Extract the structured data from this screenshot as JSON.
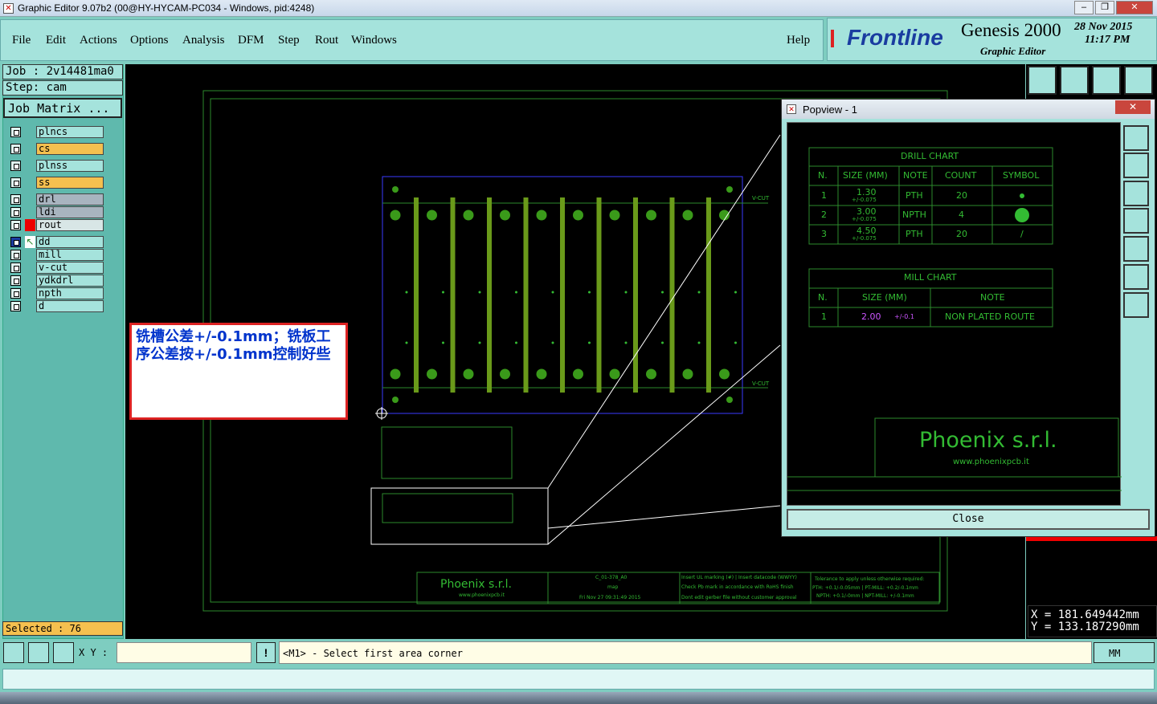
{
  "window": {
    "title": "Graphic Editor 9.07b2 (00@HY-HYCAM-PC034 - Windows, pid:4248)",
    "minimize": "–",
    "restore": "❐",
    "close": "✕"
  },
  "menu": [
    "File",
    "Edit",
    "Actions",
    "Options",
    "Analysis",
    "DFM",
    "Step",
    "Rout",
    "Windows"
  ],
  "help": "Help",
  "brand": {
    "logo": "Frontline",
    "product": "Genesis 2000",
    "subtitle": "Graphic Editor",
    "date": "28 Nov 2015",
    "time": "11:17 PM"
  },
  "job": {
    "job": "Job : 2v14481ma0",
    "step": "Step: cam",
    "matrix_button": "Job Matrix ..."
  },
  "layers": [
    {
      "name": "plncs",
      "color": "#a5e3dc"
    },
    {
      "name": "cs",
      "color": "#f5c04f"
    },
    {
      "name": "plnss",
      "color": "#a5e3dc"
    },
    {
      "name": "ss",
      "color": "#f5c04f"
    },
    {
      "name": "drl",
      "color": "#a8b4bf"
    },
    {
      "name": "ldi",
      "color": "#a8b4bf"
    },
    {
      "name": "rout",
      "color": "#a5e3dc"
    },
    {
      "name": "dd",
      "color": "#a5e3dc"
    },
    {
      "name": "mill",
      "color": "#a5e3dc"
    },
    {
      "name": "v-cut",
      "color": "#a5e3dc"
    },
    {
      "name": "ydkdrl",
      "color": "#a5e3dc"
    },
    {
      "name": "npth",
      "color": "#a5e3dc"
    },
    {
      "name": "d",
      "color": "#a5e3dc"
    }
  ],
  "selected": "Selected : 76",
  "annotation": {
    "line1": "铣槽公差+/-0.1mm；铣板工",
    "line2": "序公差按+/-0.1mm控制好些"
  },
  "popview": {
    "title": "Popview - 1",
    "close_label": "Close",
    "drill_chart": {
      "title": "DRILL CHART",
      "headers": [
        "N.",
        "SIZE (MM)",
        "NOTE",
        "COUNT",
        "SYMBOL"
      ],
      "rows": [
        {
          "n": "1",
          "size": "1.30",
          "tol": "+/-0.075",
          "note": "PTH",
          "count": "20"
        },
        {
          "n": "2",
          "size": "3.00",
          "tol": "+/-0.075",
          "note": "NPTH",
          "count": "4"
        },
        {
          "n": "3",
          "size": "4.50",
          "tol": "+/-0.075",
          "note": "PTH",
          "count": "20",
          "symbol": "/"
        }
      ]
    },
    "mill_chart": {
      "title": "MILL CHART",
      "headers": [
        "N.",
        "SIZE (MM)",
        "NOTE"
      ],
      "rows": [
        {
          "n": "1",
          "size": "2.00",
          "tol": "+/-0.1",
          "note": "NON PLATED ROUTE"
        }
      ]
    },
    "company": "Phoenix s.r.l.",
    "website": "www.phoenixpcb.it"
  },
  "board": {
    "vcut_label": "V-CUT",
    "title_block": {
      "company": "Phoenix s.r.l.",
      "website": "www.phoenixpcb.it",
      "part": "C_01-378_A0",
      "step": "map",
      "date": "Fri Nov 27 09:31:49 2015",
      "note1": "Insert UL marking (#) | Insert datacode (WWYY)",
      "note2": "Check Pb mark in accordance with RoHS finish",
      "note3": "Dont edit gerber file without customer approval",
      "tol_title": "Tolerance to apply unless otherwise required:",
      "tol1": "PTH: +0.1/-0.05mm | PT-MILL: +0.2/-0.1mm",
      "tol2": "NPTH: +0.1/-0mm | NPT-MILL: +/-0.1mm"
    }
  },
  "coords": {
    "x": "X = 181.649442mm",
    "y": "Y = 133.187290mm"
  },
  "status": {
    "xy_label": "X Y :",
    "xy_value": "",
    "prompt": "<M1> - Select first area corner",
    "units": "MM"
  }
}
